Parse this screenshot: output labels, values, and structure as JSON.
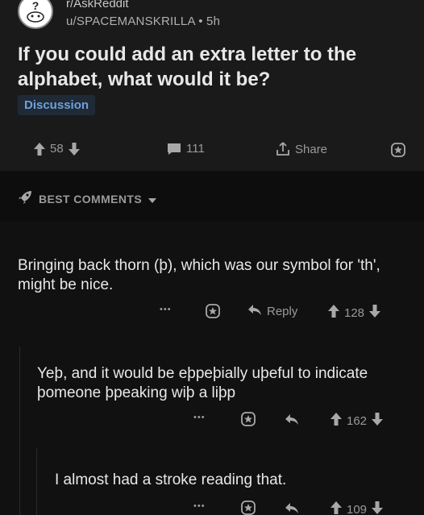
{
  "post": {
    "subreddit": "r/AskReddit",
    "author_line": "u/SPACEMANSKRILLA • 5h",
    "title": "If you could add an extra letter to the alphabet, what would it be?",
    "flair": "Discussion",
    "votes": "58",
    "comments": "111",
    "share_label": "Share"
  },
  "sort": {
    "label": "BEST COMMENTS"
  },
  "comments": [
    {
      "text": "Bringing back thorn (þ), which was our symbol for 'th', might be nice.",
      "more": "•••",
      "reply_label": "Reply",
      "votes": "128"
    },
    {
      "text": "Yeþ, and it would be eþpeþially uþeful to indicate þomeone þpeaking wiþ a liþp",
      "more": "•••",
      "votes": "162"
    },
    {
      "text": "I almost had a stroke reading that.",
      "more": "•••",
      "votes": "109"
    }
  ],
  "colors": {
    "accent": "#6ea1d8",
    "background": "#000000",
    "post_bg": "#1a1a1b"
  }
}
